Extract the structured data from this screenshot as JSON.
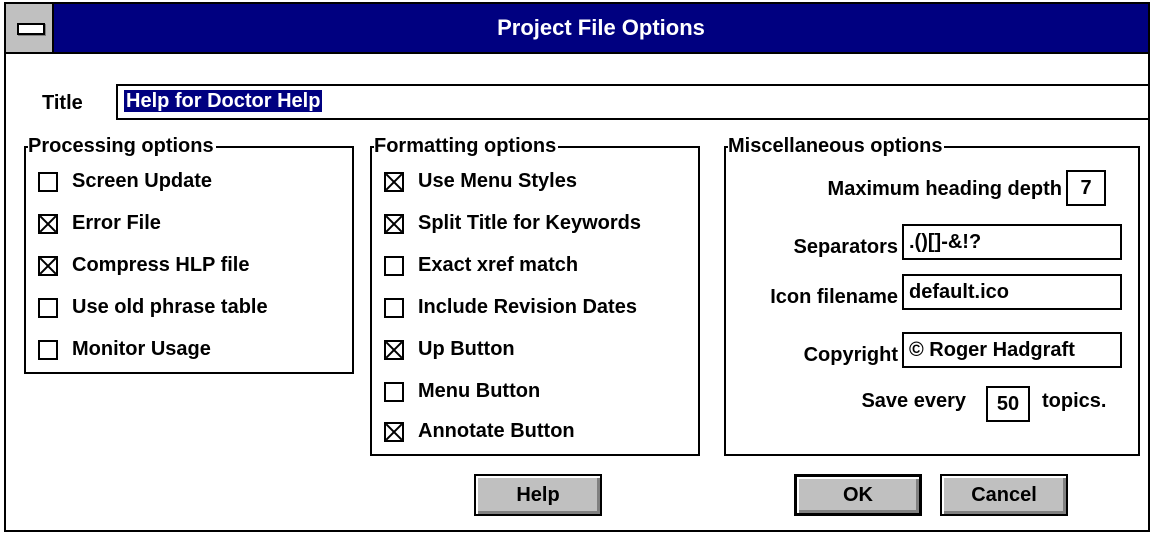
{
  "window": {
    "title": "Project File Options"
  },
  "title_field": {
    "label": "Title",
    "value": "Help for Doctor Help"
  },
  "processing": {
    "label": "Processing options",
    "items": [
      {
        "label": "Screen Update",
        "checked": false
      },
      {
        "label": "Error File",
        "checked": true
      },
      {
        "label": "Compress HLP file",
        "checked": true
      },
      {
        "label": "Use old phrase table",
        "checked": false
      },
      {
        "label": "Monitor Usage",
        "checked": false
      }
    ]
  },
  "formatting": {
    "label": "Formatting options",
    "items": [
      {
        "label": "Use Menu Styles",
        "checked": true
      },
      {
        "label": "Split Title for Keywords",
        "checked": true
      },
      {
        "label": "Exact xref match",
        "checked": false
      },
      {
        "label": "Include Revision Dates",
        "checked": false
      },
      {
        "label": "Up Button",
        "checked": true
      },
      {
        "label": "Menu Button",
        "checked": false
      },
      {
        "label": "Annotate Button",
        "checked": true
      }
    ]
  },
  "misc": {
    "label": "Miscellaneous options",
    "heading_depth_label": "Maximum heading depth",
    "heading_depth_value": "7",
    "separators_label": "Separators",
    "separators_value": ".()[]-&!?",
    "icon_label": "Icon filename",
    "icon_value": "default.ico",
    "copyright_label": "Copyright",
    "copyright_value": "© Roger Hadgraft",
    "save_every_label": "Save every",
    "save_every_value": "50",
    "save_every_suffix": "topics."
  },
  "buttons": {
    "help": "Help",
    "ok": "OK",
    "cancel": "Cancel"
  },
  "colors": {
    "titlebar": "#000080",
    "face": "#c0c0c0",
    "selection": "#000080"
  }
}
